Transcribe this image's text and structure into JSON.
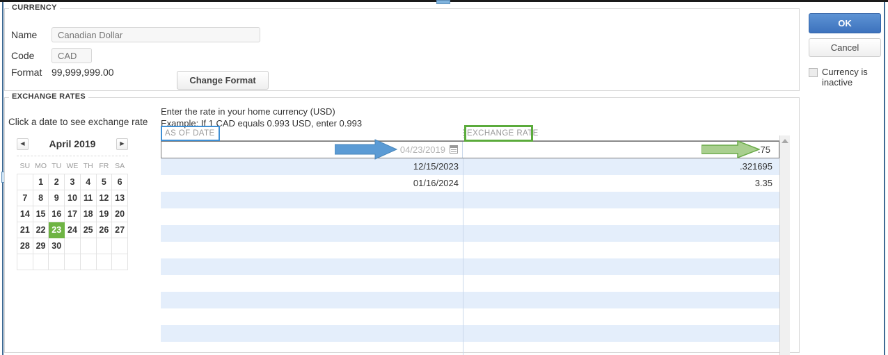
{
  "currency_section": {
    "legend": "CURRENCY",
    "fields": {
      "name_label": "Name",
      "name_value": "Canadian Dollar",
      "name_placeholder": "Canadian Dollar",
      "code_label": "Code",
      "code_value": "CAD",
      "code_placeholder": "CAD",
      "format_label": "Format",
      "format_value": "99,999,999.00"
    },
    "change_format_button": "Change Format"
  },
  "actions": {
    "ok_label": "OK",
    "cancel_label": "Cancel",
    "inactive_checkbox_label": "Currency is inactive",
    "inactive_checked": false
  },
  "exchange_section": {
    "legend": "EXCHANGE RATES",
    "calendar_hint": "Click a date to see exchange rate",
    "instructions_line1": "Enter the rate in your home currency (USD)",
    "instructions_line2": "Example: If 1 CAD equals 0.993 USD, enter 0.993"
  },
  "calendar": {
    "prev_icon": "◀",
    "next_icon": "▶",
    "title": "April 2019",
    "weekdays": [
      "SU",
      "MO",
      "TU",
      "WE",
      "TH",
      "FR",
      "SA"
    ],
    "weeks": [
      [
        "",
        "1",
        "2",
        "3",
        "4",
        "5",
        "6"
      ],
      [
        "7",
        "8",
        "9",
        "10",
        "11",
        "12",
        "13"
      ],
      [
        "14",
        "15",
        "16",
        "17",
        "18",
        "19",
        "20"
      ],
      [
        "21",
        "22",
        "23",
        "24",
        "25",
        "26",
        "27"
      ],
      [
        "28",
        "29",
        "30",
        "",
        "",
        "",
        ""
      ],
      [
        "",
        "",
        "",
        "",
        "",
        "",
        ""
      ]
    ],
    "selected_day": "23",
    "selected_color": "#6eb443"
  },
  "grid": {
    "columns": [
      {
        "key": "as_of_date",
        "label": "AS OF DATE"
      },
      {
        "key": "exchange_rate",
        "label": "EXCHANGE RATE"
      }
    ],
    "edit_row": {
      "as_of_date": "04/23/2019",
      "exchange_rate": ".75",
      "date_icon": "calendar-icon"
    },
    "rows": [
      {
        "as_of_date": "12/15/2023",
        "exchange_rate": ".321695"
      },
      {
        "as_of_date": "01/16/2024",
        "exchange_rate": "3.35"
      },
      {
        "as_of_date": "",
        "exchange_rate": ""
      },
      {
        "as_of_date": "",
        "exchange_rate": ""
      },
      {
        "as_of_date": "",
        "exchange_rate": ""
      },
      {
        "as_of_date": "",
        "exchange_rate": ""
      },
      {
        "as_of_date": "",
        "exchange_rate": ""
      },
      {
        "as_of_date": "",
        "exchange_rate": ""
      },
      {
        "as_of_date": "",
        "exchange_rate": ""
      },
      {
        "as_of_date": "",
        "exchange_rate": ""
      },
      {
        "as_of_date": "",
        "exchange_rate": ""
      },
      {
        "as_of_date": "",
        "exchange_rate": ""
      }
    ],
    "scroll_up_icon": "triangle-up"
  },
  "annotations": {
    "date_header_highlight_color": "#3f8fd4",
    "rate_header_highlight_color": "#5bab3c",
    "date_arrow_color": "#5b9bd5",
    "rate_arrow_color": "#a9cf8f"
  }
}
